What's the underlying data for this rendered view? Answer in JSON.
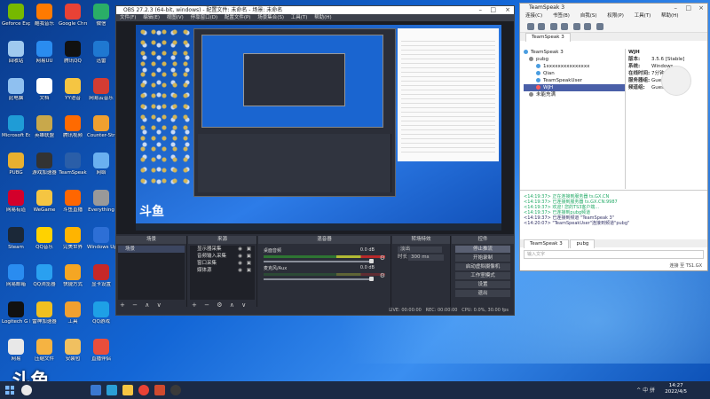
{
  "desktop": {
    "icons": [
      {
        "label": "Geforce Experience",
        "color": "#76b900"
      },
      {
        "label": "酷我音乐",
        "color": "#ff7a00"
      },
      {
        "label": "Google Chrome",
        "color": "#e94235"
      },
      {
        "label": "微信",
        "color": "#2aae67"
      },
      {
        "label": "回收站",
        "color": "#9fc9ef"
      },
      {
        "label": "网易UU",
        "color": "#2a8cf0"
      },
      {
        "label": "腾讯QQ",
        "color": "#111"
      },
      {
        "label": "迅雷",
        "color": "#1f78d1"
      },
      {
        "label": "此电脑",
        "color": "#8fc0f0"
      },
      {
        "label": "文档",
        "color": "#fff"
      },
      {
        "label": "YY语音",
        "color": "#f5c542"
      },
      {
        "label": "网易云音乐",
        "color": "#d43c33"
      },
      {
        "label": "Microsoft Edge",
        "color": "#1f9cd6"
      },
      {
        "label": "英雄联盟",
        "color": "#c8a84b"
      },
      {
        "label": "腾讯视频",
        "color": "#ff6a00"
      },
      {
        "label": "Counter-Strike",
        "color": "#f0a030"
      },
      {
        "label": "PUBG",
        "color": "#e8b030"
      },
      {
        "label": "游戏加速器",
        "color": "#333"
      },
      {
        "label": "TeamSpeak",
        "color": "#2a5ea8"
      },
      {
        "label": "网络",
        "color": "#6ab0f0"
      },
      {
        "label": "网易有道",
        "color": "#d3002b"
      },
      {
        "label": "WeGame",
        "color": "#f5c542"
      },
      {
        "label": "斗鱼直播",
        "color": "#ff6600"
      },
      {
        "label": "Everything",
        "color": "#999"
      },
      {
        "label": "Steam",
        "color": "#1b2838"
      },
      {
        "label": "QQ音乐",
        "color": "#ffd200"
      },
      {
        "label": "完美世界",
        "color": "#ffb400"
      },
      {
        "label": "Windows Update",
        "color": "#2d6fd6"
      },
      {
        "label": "网易邮箱",
        "color": "#2a8cf0"
      },
      {
        "label": "QQ浏览器",
        "color": "#2aa0f0"
      },
      {
        "label": "快捷方式",
        "color": "#f5a623"
      },
      {
        "label": "显卡设置",
        "color": "#c62828"
      },
      {
        "label": "Logitech G HUB",
        "color": "#111"
      },
      {
        "label": "雷神加速器",
        "color": "#f0c020"
      },
      {
        "label": "工具",
        "color": "#f0a030"
      },
      {
        "label": "QQ游戏",
        "color": "#1ea0e6"
      },
      {
        "label": "网易",
        "color": "#e8e8e8"
      },
      {
        "label": "压缩文件",
        "color": "#f5b342"
      },
      {
        "label": "安装包",
        "color": "#f0c060"
      },
      {
        "label": "直播伴侣",
        "color": "#e94e3c"
      }
    ]
  },
  "obs": {
    "title": "OBS 27.2.3 (64-bit, windows) - 配置文件: 未命名 - 场景: 未命名",
    "menu": [
      "文件(F)",
      "编辑(E)",
      "视图(V)",
      "停靠窗口(D)",
      "配置文件(P)",
      "场景集合(S)",
      "工具(T)",
      "帮助(H)"
    ],
    "scenes_header": "场景",
    "scenes": [
      "场景"
    ],
    "sources_header": "来源",
    "sources": [
      "显示器采集",
      "音频输入采集",
      "窗口采集",
      "媒体源"
    ],
    "mixer_header": "混音器",
    "mixer": [
      {
        "label": "桌面音频",
        "db": "0.0 dB"
      },
      {
        "label": "麦克风/Aux",
        "db": "0.0 dB"
      }
    ],
    "transitions_header": "转场特效",
    "transition_type": "淡出",
    "duration_label": "时长",
    "duration_value": "300 ms",
    "controls_header": "控件",
    "controls": [
      "停止推流",
      "开始录制",
      "启动虚拟摄像机",
      "工作室模式",
      "设置",
      "退出"
    ],
    "status": {
      "live": "LIVE: 00:00:00",
      "rec": "REC: 00:00:00",
      "cpu": "CPU: 0.0%, 30.00 fps"
    },
    "preview_logo": "斗鱼"
  },
  "teamspeak": {
    "title": "TeamSpeak 3",
    "menu": [
      "连接(C)",
      "书签(B)",
      "自我(S)",
      "权限(P)",
      "工具(T)",
      "帮助(H)"
    ],
    "tab": "TeamSpeak 3",
    "server": "pubg",
    "channels": [
      "1xxxxxxxxxxxxxxx",
      "Qian",
      "TeamSpeakUser",
      "WJH"
    ],
    "selected_user": "WJH",
    "away": "未能充满",
    "info": {
      "name": "WJH",
      "version_label": "版本:",
      "version": "3.5.6 [Stable]",
      "os_label": "系统:",
      "os": "Windows",
      "online_label": "在线时间:",
      "online": "7分钟40秒",
      "group_label": "服务器组:",
      "group": "Guest",
      "channel_group_label": "频道组:",
      "channel_group": "Guest"
    },
    "log": [
      "<14:19:37> 正在连接到服务器 ts.GX.CN",
      "<14:19:37> 已连接到服务器 ts.GX.CN:9987",
      "<14:19:37> 欢迎! 您的TS3客户端...",
      "<14:19:37> 已连接到pubg频道",
      "<14:19:37> 已连接到频道 \"TeamSpeak 3\"",
      "<14:20:07> \"TeamSpeakUser\"连接到频道\"pubg\""
    ],
    "log_tabs": [
      "TeamSpeak 3",
      "pubg"
    ],
    "input_placeholder": "输入文字",
    "status": "连接 至 TS1.GX"
  },
  "taskbar": {
    "time": "14:27",
    "date": "2022/4/5",
    "tray": "^ 中 拼"
  },
  "stream_logo": "斗鱼"
}
